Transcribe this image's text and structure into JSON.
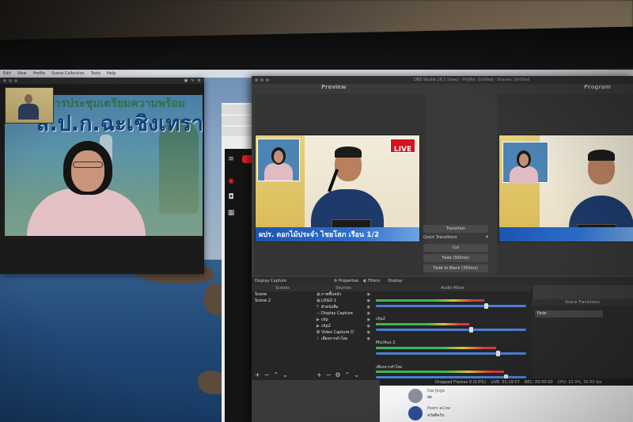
{
  "menubar": {
    "items": [
      "Edit",
      "View",
      "Profile",
      "Scene Collection",
      "Tools",
      "Help"
    ]
  },
  "obs": {
    "title": "OBS Studio 26.1 (mac) - Profile: Untitled - Scenes: Untitled",
    "preview_label": "Preview",
    "program_label": "Program",
    "transition_button": "Transition",
    "quick_transitions_label": "Quick Transitions",
    "quick_transitions": [
      "Cut",
      "Fade (300ms)",
      "Fade to Black (300ms)"
    ],
    "source_bar_name": "Display Capture",
    "tabs": [
      "Properties",
      "Filters"
    ],
    "tab_display": "Display",
    "docks": {
      "scenes_title": "Scenes",
      "sources_title": "Sources",
      "mixer_title": "Audio Mixer",
      "transitions_title": "Scene Transitions"
    },
    "scenes": [
      "Scene",
      "Scene 2"
    ],
    "sources": [
      {
        "icon": "image-icon",
        "label": "ภาพพื้นหลัง"
      },
      {
        "icon": "image-icon",
        "label": "LOGO 1"
      },
      {
        "icon": "text-icon",
        "label": "ตัวหนังสือ"
      },
      {
        "icon": "display-icon",
        "label": "Display Capture"
      },
      {
        "icon": "media-icon",
        "label": "clip"
      },
      {
        "icon": "media-icon",
        "label": "clip2"
      },
      {
        "icon": "camera-icon",
        "label": "Video Capture D"
      },
      {
        "icon": "audio-icon",
        "label": "เสียงจากลำโพง"
      }
    ],
    "mixer": [
      {
        "name": "",
        "level": 0.72
      },
      {
        "name": "clip2",
        "level": 0.62
      },
      {
        "name": "Mic/Aux 2",
        "level": 0.8
      },
      {
        "name": "เสียงจากลำโพง",
        "level": 0.85
      }
    ],
    "transition_selected": "Fade",
    "status": {
      "dropped": "Dropped Frames 0 (0.0%)",
      "live": "LIVE: 01:19:57",
      "rec": "REC: 00:00:00",
      "cpu": "CPU: 10.3%, 30.00 fps"
    }
  },
  "broadcast": {
    "live_badge": "LIVE",
    "lower_third": "ผปร. ดอกไม้ประจำ ไชยโสภ เรือน 1/2"
  },
  "zoom_banner": {
    "line1": "การประชุมเตรียมความพร้อม",
    "line2": "ส.ป.ก.ฉะเชิงเทรา"
  },
  "chat": [
    {
      "name": "Dai Jingo",
      "text": "ok"
    },
    {
      "name": "Poom aCow",
      "text": "สวัสดีครับ"
    }
  ],
  "colors": {
    "obs_bg": "#3a3a3a",
    "live_red": "#d4131c",
    "lower_third_blue": "#1a55b0",
    "youtube_red": "#e02020"
  }
}
